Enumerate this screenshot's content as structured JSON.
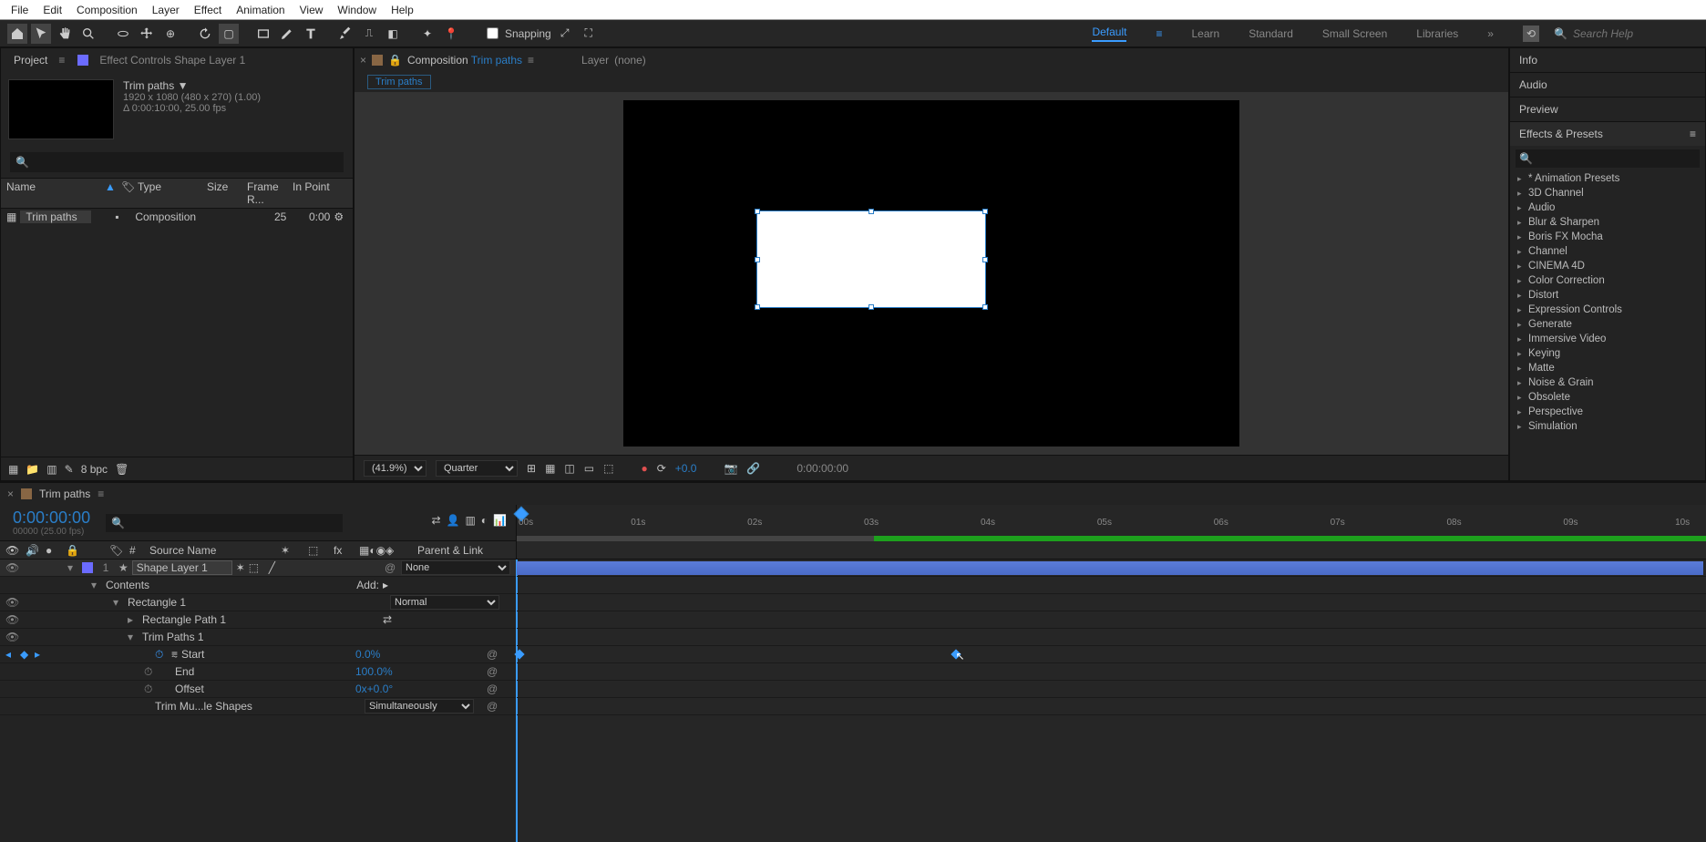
{
  "menubar": [
    "File",
    "Edit",
    "Composition",
    "Layer",
    "Effect",
    "Animation",
    "View",
    "Window",
    "Help"
  ],
  "tools": {
    "snapping": "Snapping"
  },
  "workspaces": {
    "items": [
      "Default",
      "Learn",
      "Standard",
      "Small Screen",
      "Libraries"
    ],
    "active": "Default"
  },
  "search": {
    "placeholder": "Search Help"
  },
  "project": {
    "tab1": "Project",
    "tab2": "Effect Controls Shape Layer 1",
    "comp_name": "Trim paths",
    "dim": "1920 x 1080  (480 x 270) (1.00)",
    "dur": "Δ 0:00:10:00, 25.00 fps",
    "cols": {
      "name": "Name",
      "type": "Type",
      "size": "Size",
      "fr": "Frame R...",
      "in": "In Point"
    },
    "item": {
      "name": "Trim paths",
      "type": "Composition",
      "fr": "25",
      "in": "0:00"
    },
    "footer": {
      "bpc": "8 bpc"
    }
  },
  "comp": {
    "prefix": "Composition",
    "link": "Trim paths",
    "layer_label": "Layer",
    "none": "(none)",
    "flow": "Trim paths",
    "footer": {
      "zoom": "(41.9%)",
      "quality": "Quarter",
      "adj": "+0.0",
      "tc": "0:00:00:00"
    }
  },
  "side": {
    "tabs": [
      "Info",
      "Audio",
      "Preview"
    ],
    "effects_title": "Effects & Presets",
    "presets": [
      "* Animation Presets",
      "3D Channel",
      "Audio",
      "Blur & Sharpen",
      "Boris FX Mocha",
      "Channel",
      "CINEMA 4D",
      "Color Correction",
      "Distort",
      "Expression Controls",
      "Generate",
      "Immersive Video",
      "Keying",
      "Matte",
      "Noise & Grain",
      "Obsolete",
      "Perspective",
      "Simulation"
    ]
  },
  "timeline": {
    "tab": "Trim paths",
    "time": "0:00:00:00",
    "time_sub": "00000 (25.00 fps)",
    "cols": {
      "num": "#",
      "source": "Source Name",
      "parent": "Parent & Link"
    },
    "ticks": [
      "00s",
      "01s",
      "02s",
      "03s",
      "04s",
      "05s",
      "06s",
      "07s",
      "08s",
      "09s",
      "10s"
    ],
    "layer": {
      "idx": "1",
      "name": "Shape Layer 1",
      "mode": "None",
      "contents": "Contents",
      "add": "Add:",
      "rect1": "Rectangle 1",
      "rect_mode": "Normal",
      "rectpath": "Rectangle Path 1",
      "trim": "Trim Paths 1",
      "start": "Start",
      "start_v": "0.0%",
      "end": "End",
      "end_v": "100.0%",
      "offset": "Offset",
      "offset_v": "0x+0.0°",
      "multi": "Trim Mu...le Shapes",
      "multi_v": "Simultaneously"
    }
  }
}
